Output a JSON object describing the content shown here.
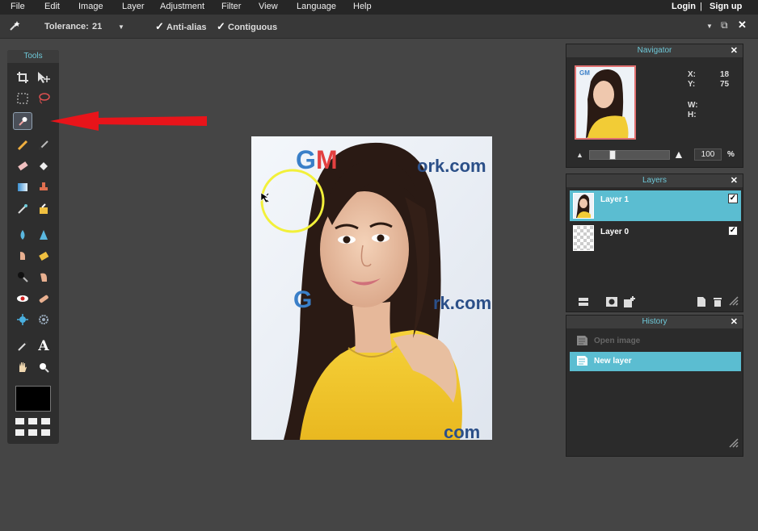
{
  "menubar": {
    "items": [
      "File",
      "Edit",
      "Image",
      "Layer",
      "Adjustment",
      "Filter",
      "View",
      "Language",
      "Help"
    ],
    "login": "Login",
    "separator": "|",
    "signup": "Sign up"
  },
  "options": {
    "tolerance_label": "Tolerance:",
    "tolerance_value": "21",
    "antialias_label": "Anti-alias",
    "antialias_checked": true,
    "contiguous_label": "Contiguous",
    "contiguous_checked": true
  },
  "tools": {
    "title": "Tools",
    "active_tool": "magic-wand",
    "foreground_color": "#000000"
  },
  "canvas": {
    "photo_text_top": "GM    twork.com",
    "photo_text_mid": "G        rk.com",
    "photo_text_bottom": "com"
  },
  "navigator": {
    "title": "Navigator",
    "x_label": "X:",
    "x_value": "18",
    "y_label": "Y:",
    "y_value": "75",
    "w_label": "W:",
    "h_label": "H:",
    "zoom_value": "100",
    "zoom_unit": "%"
  },
  "layers": {
    "title": "Layers",
    "items": [
      {
        "name": "Layer 1",
        "selected": true,
        "visible": true
      },
      {
        "name": "Layer 0",
        "selected": false,
        "visible": true
      }
    ]
  },
  "history": {
    "title": "History",
    "items": [
      {
        "name": "Open image",
        "selected": false
      },
      {
        "name": "New layer",
        "selected": true
      }
    ]
  },
  "colors": {
    "accent": "#5bbdd1",
    "panel_title": "#6ec8d8",
    "arrow": "#e8141a",
    "circle": "#f2f03a"
  }
}
